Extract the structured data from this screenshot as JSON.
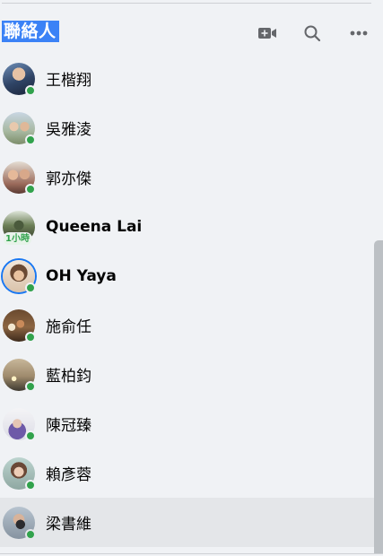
{
  "header": {
    "title": "聯絡人",
    "actions": [
      {
        "name": "video-call-icon",
        "label": ""
      },
      {
        "name": "search-icon",
        "label": ""
      },
      {
        "name": "more-options-icon",
        "label": ""
      }
    ]
  },
  "contacts": [
    {
      "name": "王楷翔",
      "online": true,
      "bold": false
    },
    {
      "name": "吳雅淩",
      "online": true,
      "bold": false
    },
    {
      "name": "郭亦傑",
      "online": true,
      "bold": false
    },
    {
      "name": "Queena Lai",
      "online": false,
      "bold": true,
      "badge": "1小時"
    },
    {
      "name": "OH Yaya",
      "online": true,
      "bold": true,
      "story_ring": true
    },
    {
      "name": "施俞任",
      "online": true,
      "bold": false
    },
    {
      "name": "藍柏鈞",
      "online": true,
      "bold": false
    },
    {
      "name": "陳冠臻",
      "online": true,
      "bold": false
    },
    {
      "name": "賴彥蓉",
      "online": true,
      "bold": false
    },
    {
      "name": "梁書維",
      "online": true,
      "bold": false,
      "hovered": true
    }
  ],
  "colors": {
    "background": "#f0f2f5",
    "online": "#31a24c",
    "title_highlight": "#3b82f6",
    "story_ring": "#1877f2",
    "hover": "#e4e6e9"
  }
}
